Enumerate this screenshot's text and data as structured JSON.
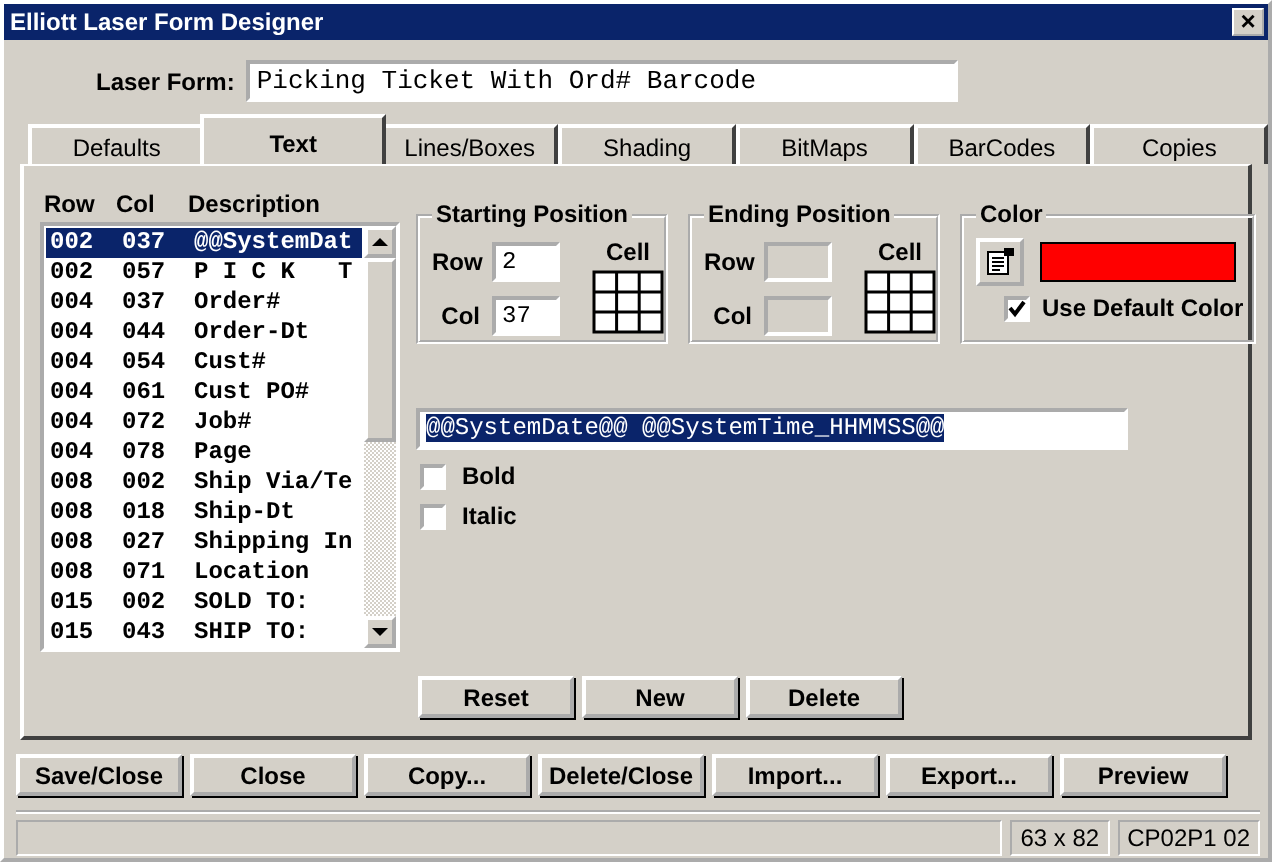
{
  "window": {
    "title": "Elliott Laser Form Designer",
    "close": "×"
  },
  "laser_form": {
    "label": "Laser Form:",
    "value": "Picking Ticket With Ord# Barcode"
  },
  "tabs": [
    {
      "label": "Defaults",
      "selected": false
    },
    {
      "label": "Text",
      "selected": true
    },
    {
      "label": "Lines/Boxes",
      "selected": false
    },
    {
      "label": "Shading",
      "selected": false
    },
    {
      "label": "BitMaps",
      "selected": false
    },
    {
      "label": "BarCodes",
      "selected": false
    },
    {
      "label": "Copies",
      "selected": false
    }
  ],
  "list": {
    "columns": [
      "Row",
      "Col",
      "Description"
    ],
    "rows": [
      {
        "row": "002",
        "col": "037",
        "description": "@@SystemDat",
        "selected": true
      },
      {
        "row": "002",
        "col": "057",
        "description": "P I C K   T",
        "selected": false
      },
      {
        "row": "004",
        "col": "037",
        "description": "Order#",
        "selected": false
      },
      {
        "row": "004",
        "col": "044",
        "description": "Order-Dt",
        "selected": false
      },
      {
        "row": "004",
        "col": "054",
        "description": "Cust#",
        "selected": false
      },
      {
        "row": "004",
        "col": "061",
        "description": "Cust PO#",
        "selected": false
      },
      {
        "row": "004",
        "col": "072",
        "description": "Job#",
        "selected": false
      },
      {
        "row": "004",
        "col": "078",
        "description": "Page",
        "selected": false
      },
      {
        "row": "008",
        "col": "002",
        "description": "Ship Via/Te",
        "selected": false
      },
      {
        "row": "008",
        "col": "018",
        "description": "Ship-Dt",
        "selected": false
      },
      {
        "row": "008",
        "col": "027",
        "description": "Shipping In",
        "selected": false
      },
      {
        "row": "008",
        "col": "071",
        "description": "Location",
        "selected": false
      },
      {
        "row": "015",
        "col": "002",
        "description": "SOLD TO:",
        "selected": false
      },
      {
        "row": "015",
        "col": "043",
        "description": "SHIP TO:",
        "selected": false
      }
    ]
  },
  "starting_position": {
    "title": "Starting Position",
    "row_label": "Row",
    "row_value": "2",
    "col_label": "Col",
    "col_value": "37",
    "cell_label": "Cell"
  },
  "ending_position": {
    "title": "Ending Position",
    "row_label": "Row",
    "col_label": "Col",
    "cell_label": "Cell",
    "disabled": true
  },
  "color": {
    "title": "Color",
    "color": "#ff0000",
    "use_default_label": "Use Default Color",
    "use_default_checked": true
  },
  "text_value": "@@SystemDate@@ @@SystemTime_HHMMSS@@",
  "options": [
    {
      "label": "Bold",
      "checked": false
    },
    {
      "label": "Italic",
      "checked": false
    }
  ],
  "list_buttons": [
    "Reset",
    "New",
    "Delete"
  ],
  "buttons": [
    "Save/Close",
    "Close",
    "Copy...",
    "Delete/Close",
    "Import...",
    "Export...",
    "Preview"
  ],
  "status_bar": {
    "size": "63 x 82",
    "code": "CP02P1 02"
  }
}
